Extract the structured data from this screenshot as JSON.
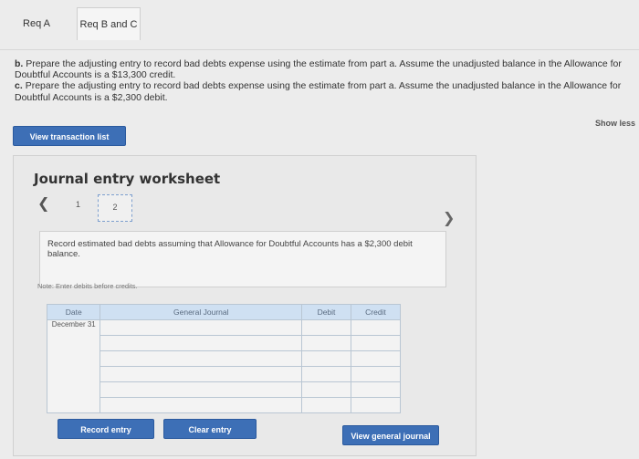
{
  "tabs": [
    {
      "label": "Req A"
    },
    {
      "label": "Req B and C"
    }
  ],
  "prompt": {
    "b_label": "b.",
    "b_text": "Prepare the adjusting entry to record bad debts expense using the estimate from part a. Assume the unadjusted balance in the Allowance for Doubtful Accounts is a $13,300 credit.",
    "c_label": "c.",
    "c_text": "Prepare the adjusting entry to record bad debts expense using the estimate from part a. Assume the unadjusted balance in the Allowance for Doubtful Accounts is a $2,300 debit."
  },
  "show_less": "Show less",
  "view_transaction_list": "View transaction list",
  "worksheet": {
    "title": "Journal entry worksheet",
    "pages": [
      "1",
      "2"
    ],
    "instruction": "Record estimated bad debts assuming that Allowance for Doubtful Accounts has a $2,300 debit balance.",
    "note": "Note: Enter debits before credits.",
    "table": {
      "headers": {
        "date": "Date",
        "account": "General Journal",
        "debit": "Debit",
        "credit": "Credit"
      },
      "rows": [
        {
          "date": "December 31",
          "account": "",
          "debit": "",
          "credit": ""
        },
        {
          "date": "",
          "account": "",
          "debit": "",
          "credit": ""
        },
        {
          "date": "",
          "account": "",
          "debit": "",
          "credit": ""
        },
        {
          "date": "",
          "account": "",
          "debit": "",
          "credit": ""
        },
        {
          "date": "",
          "account": "",
          "debit": "",
          "credit": ""
        },
        {
          "date": "",
          "account": "",
          "debit": "",
          "credit": ""
        }
      ]
    },
    "buttons": {
      "record": "Record entry",
      "clear": "Clear entry",
      "view_journal": "View general journal"
    }
  },
  "colors": {
    "button_blue": "#3d6fb6",
    "header_blue": "#cfe0f2"
  }
}
